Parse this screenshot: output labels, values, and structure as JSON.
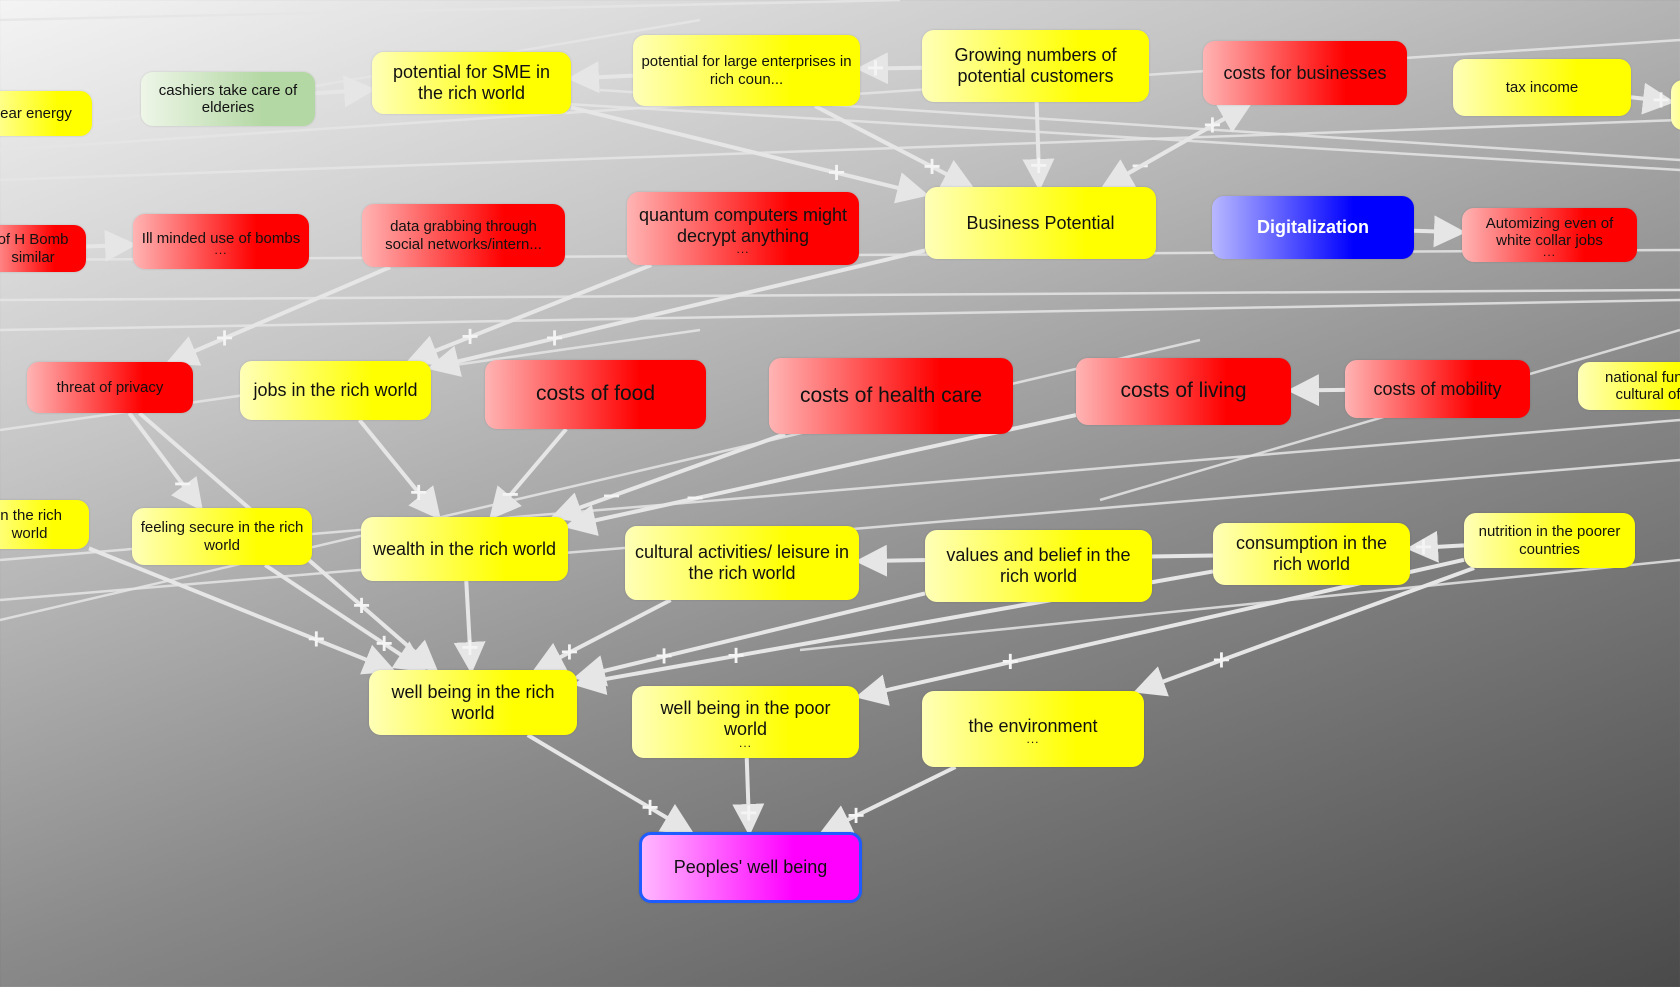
{
  "colors": {
    "edge": "#e6e6e6",
    "yellow": "#ffff00",
    "red": "#ff0000",
    "blue": "#0000ff",
    "green": "#b4d8a4",
    "magenta": "#ff00ff",
    "focus_border": "#1e5cff"
  },
  "nodes": [
    {
      "id": "nuclear",
      "label": "ear energy",
      "color": "yellow"
    },
    {
      "id": "cashiers",
      "label": "cashiers take care of elderies",
      "color": "green"
    },
    {
      "id": "sme",
      "label": "potential for SME in the rich world",
      "color": "yellow"
    },
    {
      "id": "large",
      "label": "potential for large enterprises in rich coun...",
      "color": "yellow"
    },
    {
      "id": "growing",
      "label": "Growing numbers of potential customers",
      "color": "yellow"
    },
    {
      "id": "costbiz",
      "label": "costs for businesses",
      "color": "red"
    },
    {
      "id": "tax",
      "label": "tax income",
      "color": "yellow"
    },
    {
      "id": "edge1",
      "label": "",
      "color": "yellow"
    },
    {
      "id": "hbomb",
      "label": "of H Bomb similar",
      "color": "red"
    },
    {
      "id": "illminded",
      "label": "Ill minded use of bombs",
      "color": "red",
      "more": "..."
    },
    {
      "id": "datagrab",
      "label": "data grabbing through social networks/intern...",
      "color": "red"
    },
    {
      "id": "quantum",
      "label": "quantum computers might decrypt anything",
      "color": "red",
      "more": "..."
    },
    {
      "id": "bizpot",
      "label": "Business Potential",
      "color": "yellow"
    },
    {
      "id": "digital",
      "label": "Digitalization",
      "color": "blue"
    },
    {
      "id": "automizing",
      "label": "Automizing even of white collar jobs",
      "color": "red",
      "more": "..."
    },
    {
      "id": "privacy",
      "label": "threat of privacy",
      "color": "red"
    },
    {
      "id": "jobs",
      "label": "jobs in the rich world",
      "color": "yellow"
    },
    {
      "id": "food",
      "label": "costs of food",
      "color": "red"
    },
    {
      "id": "health",
      "label": "costs of health care",
      "color": "red"
    },
    {
      "id": "living",
      "label": "costs of living",
      "color": "red"
    },
    {
      "id": "mobility",
      "label": "costs of mobility",
      "color": "red"
    },
    {
      "id": "national",
      "label": "national fund cultural of",
      "color": "yellow"
    },
    {
      "id": "inrich",
      "label": "in the rich world",
      "color": "yellow"
    },
    {
      "id": "secure",
      "label": "feeling secure in the rich world",
      "color": "yellow"
    },
    {
      "id": "wealth",
      "label": "wealth in the rich world",
      "color": "yellow"
    },
    {
      "id": "cultural",
      "label": "cultural activities/ leisure in the rich world",
      "color": "yellow"
    },
    {
      "id": "values",
      "label": "values and belief in the rich world",
      "color": "yellow"
    },
    {
      "id": "consumption",
      "label": "consumption in the rich world",
      "color": "yellow"
    },
    {
      "id": "nutrition",
      "label": "nutrition in the poorer countries",
      "color": "yellow"
    },
    {
      "id": "wbrich",
      "label": "well being in the rich world",
      "color": "yellow"
    },
    {
      "id": "wbpoor",
      "label": "well being in the poor world",
      "color": "yellow",
      "more": "..."
    },
    {
      "id": "environment",
      "label": "the environment",
      "color": "yellow",
      "more": "..."
    },
    {
      "id": "peoples",
      "label": "Peoples' well being",
      "color": "magenta"
    }
  ],
  "edges": [
    {
      "from": "hbomb",
      "to": "illminded",
      "sign": ""
    },
    {
      "from": "cashiers",
      "to": "sme",
      "sign": ""
    },
    {
      "from": "large",
      "to": "sme",
      "sign": ""
    },
    {
      "from": "growing",
      "to": "bizpot",
      "sign": "+"
    },
    {
      "from": "costbiz",
      "to": "bizpot",
      "sign": "−"
    },
    {
      "from": "sme",
      "to": "bizpot",
      "sign": "+"
    },
    {
      "from": "large",
      "to": "bizpot",
      "sign": "+"
    },
    {
      "from": "bizpot",
      "to": "costbiz",
      "sign": "+"
    },
    {
      "from": "digital",
      "to": "automizing",
      "sign": ""
    },
    {
      "from": "mobility",
      "to": "living",
      "sign": ""
    },
    {
      "from": "bizpot",
      "to": "jobs",
      "sign": "+"
    },
    {
      "from": "quantum",
      "to": "jobs",
      "sign": "+"
    },
    {
      "from": "jobs",
      "to": "wealth",
      "sign": "+"
    },
    {
      "from": "food",
      "to": "wealth",
      "sign": "−"
    },
    {
      "from": "health",
      "to": "wealth",
      "sign": "−"
    },
    {
      "from": "living",
      "to": "wealth",
      "sign": "−"
    },
    {
      "from": "privacy",
      "to": "secure",
      "sign": "−"
    },
    {
      "from": "privacy",
      "to": "wbrich",
      "sign": "+"
    },
    {
      "from": "wealth",
      "to": "wbrich",
      "sign": "+"
    },
    {
      "from": "secure",
      "to": "wbrich",
      "sign": "+"
    },
    {
      "from": "inrich",
      "to": "wbrich",
      "sign": "+"
    },
    {
      "from": "cultural",
      "to": "wbrich",
      "sign": "+"
    },
    {
      "from": "values",
      "to": "wbrich",
      "sign": "+"
    },
    {
      "from": "consumption",
      "to": "wbrich",
      "sign": "+"
    },
    {
      "from": "consumption",
      "to": "cultural",
      "sign": "+"
    },
    {
      "from": "nutrition",
      "to": "consumption",
      "sign": "+"
    },
    {
      "from": "nutrition",
      "to": "wbpoor",
      "sign": "+"
    },
    {
      "from": "nutrition",
      "to": "environment",
      "sign": "+"
    },
    {
      "from": "wbrich",
      "to": "peoples",
      "sign": "+"
    },
    {
      "from": "wbpoor",
      "to": "peoples",
      "sign": "+"
    },
    {
      "from": "environment",
      "to": "peoples",
      "sign": "+"
    },
    {
      "from": "tax",
      "to": "edge1",
      "sign": "+"
    },
    {
      "from": "datagrab",
      "to": "privacy",
      "sign": "+"
    },
    {
      "from": "growing",
      "to": "large",
      "sign": "+"
    }
  ]
}
